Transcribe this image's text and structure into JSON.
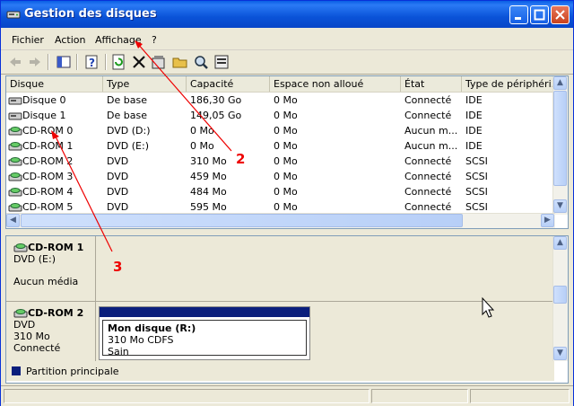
{
  "window": {
    "title": "Gestion des disques"
  },
  "menu": [
    "Fichier",
    "Action",
    "Affichage",
    "?"
  ],
  "toolbar_icons": [
    "back-arrow-icon",
    "forward-arrow-icon",
    "console-tree-icon",
    "help-icon",
    "refresh-icon",
    "delete-icon",
    "properties-icon",
    "open-icon",
    "explore-icon",
    "help-topics-icon"
  ],
  "list": {
    "columns": [
      "Disque",
      "Type",
      "Capacité",
      "Espace non alloué",
      "État",
      "Type de périphéri..."
    ],
    "rows": [
      {
        "disk": "Disque 0",
        "type": "De base",
        "capacity": "186,30 Go",
        "unalloc": "0 Mo",
        "state": "Connecté",
        "dev": "IDE",
        "kind": "hdd"
      },
      {
        "disk": "Disque 1",
        "type": "De base",
        "capacity": "149,05 Go",
        "unalloc": "0 Mo",
        "state": "Connecté",
        "dev": "IDE",
        "kind": "hdd"
      },
      {
        "disk": "CD-ROM 0",
        "type": "DVD (D:)",
        "capacity": "0 Mo",
        "unalloc": "0 Mo",
        "state": "Aucun m...",
        "dev": "IDE",
        "kind": "cd"
      },
      {
        "disk": "CD-ROM 1",
        "type": "DVD (E:)",
        "capacity": "0 Mo",
        "unalloc": "0 Mo",
        "state": "Aucun m...",
        "dev": "IDE",
        "kind": "cd"
      },
      {
        "disk": "CD-ROM 2",
        "type": "DVD",
        "capacity": "310 Mo",
        "unalloc": "0 Mo",
        "state": "Connecté",
        "dev": "SCSI",
        "kind": "cd"
      },
      {
        "disk": "CD-ROM 3",
        "type": "DVD",
        "capacity": "459 Mo",
        "unalloc": "0 Mo",
        "state": "Connecté",
        "dev": "SCSI",
        "kind": "cd"
      },
      {
        "disk": "CD-ROM 4",
        "type": "DVD",
        "capacity": "484 Mo",
        "unalloc": "0 Mo",
        "state": "Connecté",
        "dev": "SCSI",
        "kind": "cd"
      },
      {
        "disk": "CD-ROM 5",
        "type": "DVD",
        "capacity": "595 Mo",
        "unalloc": "0 Mo",
        "state": "Connecté",
        "dev": "SCSI",
        "kind": "cd"
      }
    ]
  },
  "graph": {
    "disk1": {
      "name": "CD-ROM 1",
      "line2": "DVD (E:)",
      "line3": "Aucun média"
    },
    "disk2": {
      "name": "CD-ROM 2",
      "line2": "DVD",
      "line3": "310 Mo",
      "line4": "Connecté",
      "volume": {
        "name": "Mon disque  (R:)",
        "fs": "310 Mo CDFS",
        "status": "Sain"
      }
    },
    "legend": "Partition principale",
    "legend_color": "#0a1e7c"
  },
  "annotations": [
    "2",
    "3"
  ],
  "annotation_color": "#e00000"
}
